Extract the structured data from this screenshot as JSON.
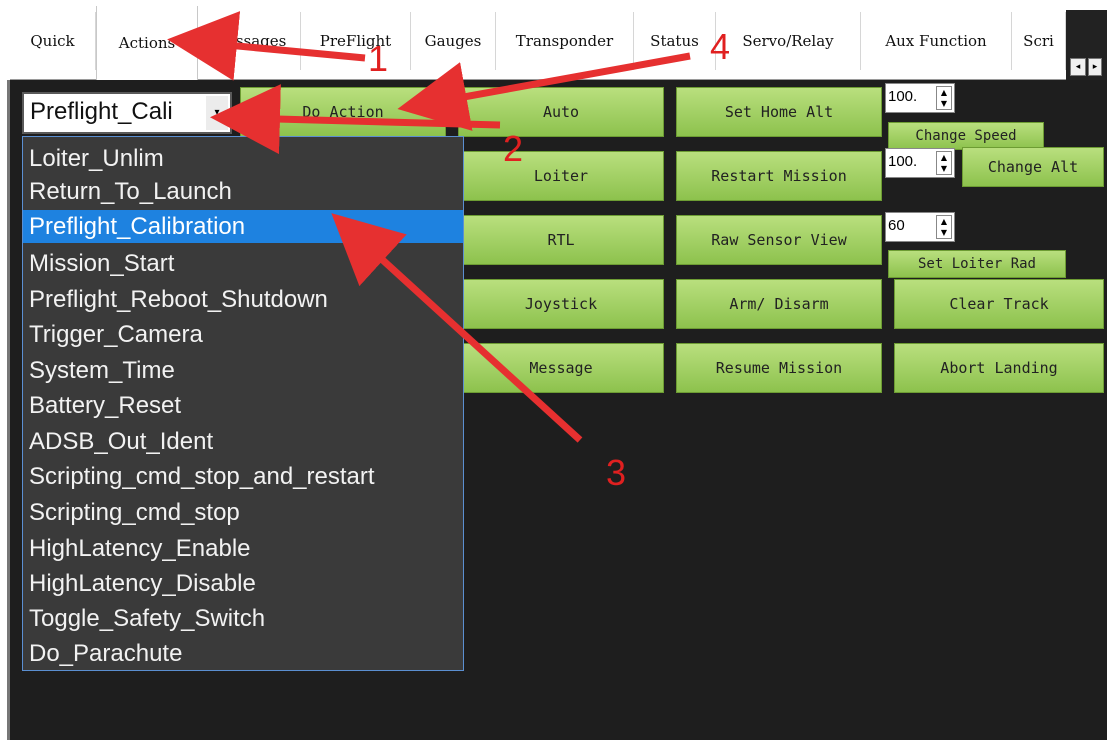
{
  "tabs": [
    {
      "label": "Quick"
    },
    {
      "label": "Actions"
    },
    {
      "label": "Messages"
    },
    {
      "label": "PreFlight"
    },
    {
      "label": "Gauges"
    },
    {
      "label": "Transponder"
    },
    {
      "label": "Status"
    },
    {
      "label": "Servo/Relay"
    },
    {
      "label": "Aux Function"
    },
    {
      "label": "Scri"
    }
  ],
  "tab_scroll": {
    "left": "◂",
    "right": "▸"
  },
  "action_combo": {
    "value": "Preflight_Cali",
    "arrow": "▾"
  },
  "action_list": [
    "Loiter_Unlim",
    "Return_To_Launch",
    "Preflight_Calibration",
    "Mission_Start",
    "Preflight_Reboot_Shutdown",
    "Trigger_Camera",
    "System_Time",
    "Battery_Reset",
    "ADSB_Out_Ident",
    "Scripting_cmd_stop_and_restart",
    "Scripting_cmd_stop",
    "HighLatency_Enable",
    "HighLatency_Disable",
    "Toggle_Safety_Switch",
    "Do_Parachute"
  ],
  "selected_action": "Preflight_Calibration",
  "buttons": {
    "do_action": "Do Action",
    "auto": "Auto",
    "set_home_alt": "Set Home Alt",
    "loiter": "Loiter",
    "restart_mission": "Restart Mission",
    "rtl": "RTL",
    "raw_sensor_view": "Raw Sensor View",
    "joystick": "Joystick",
    "arm_disarm": "Arm/ Disarm",
    "clear_track": "Clear Track",
    "message": "Message",
    "resume_mission": "Resume Mission",
    "abort_landing": "Abort Landing",
    "change_speed": "Change Speed",
    "change_alt": "Change Alt",
    "set_loiter_rad": "Set Loiter Rad"
  },
  "spinners": {
    "speed": "100.",
    "alt": "100.",
    "loiter_rad": "60"
  },
  "annotations": {
    "n1": "1",
    "n2": "2",
    "n3": "3",
    "n4": "4"
  },
  "colors": {
    "accent": "#e02020",
    "button": "#a6d064",
    "selection": "#1e82e0",
    "panel": "#1e1e1e"
  }
}
